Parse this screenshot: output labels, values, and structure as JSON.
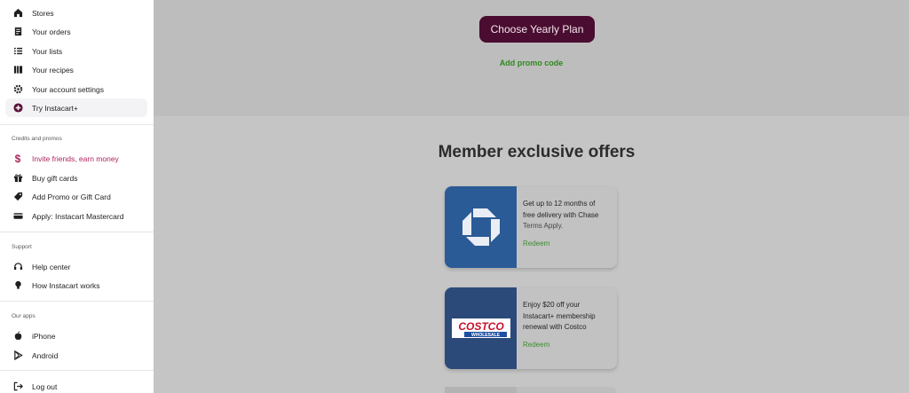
{
  "sidebar": {
    "top_items": [
      {
        "label": "Stores",
        "icon": "home-icon"
      },
      {
        "label": "Your orders",
        "icon": "receipt-icon"
      },
      {
        "label": "Your lists",
        "icon": "list-icon"
      },
      {
        "label": "Your recipes",
        "icon": "recipe-book-icon"
      },
      {
        "label": "Your account settings",
        "icon": "gear-icon"
      },
      {
        "label": "Try Instacart+",
        "icon": "instacart-plus-icon"
      }
    ],
    "credits_label": "Credits and promos",
    "credit_items": [
      {
        "label": "Invite friends, earn money",
        "icon": "dollar-icon"
      },
      {
        "label": "Buy gift cards",
        "icon": "gift-icon"
      },
      {
        "label": "Add Promo or Gift Card",
        "icon": "tag-icon"
      },
      {
        "label": "Apply: Instacart Mastercard",
        "icon": "credit-card-icon"
      }
    ],
    "support_label": "Support",
    "support_items": [
      {
        "label": "Help center",
        "icon": "headset-icon"
      },
      {
        "label": "How Instacart works",
        "icon": "lightbulb-icon"
      }
    ],
    "apps_label": "Our apps",
    "app_items": [
      {
        "label": "iPhone",
        "icon": "apple-icon"
      },
      {
        "label": "Android",
        "icon": "play-store-icon"
      }
    ],
    "logout_label": "Log out"
  },
  "main": {
    "yearly_button": "Choose Yearly Plan",
    "promo_link": "Add promo code",
    "offers_title": "Member exclusive offers",
    "offers": [
      {
        "line1": "Get up to 12 months of",
        "line2": "free delivery with Chase",
        "terms": "Terms Apply.",
        "action": "Redeem",
        "logo": "chase-logo"
      },
      {
        "line1": "Enjoy $20 off your",
        "line2": "Instacart+ membership",
        "line3": "renewal with Costco",
        "action": "Redeem",
        "logo": "costco-logo",
        "logo_text": "COSTCO",
        "logo_subtext": "WHOLESALE"
      }
    ]
  },
  "colors": {
    "brand_button": "#4a0c30",
    "promo_green": "#2e8a1d",
    "pink_accent": "#b0245f",
    "chase_blue": "#2b5b96",
    "costco_bg": "#2b4a7a"
  }
}
